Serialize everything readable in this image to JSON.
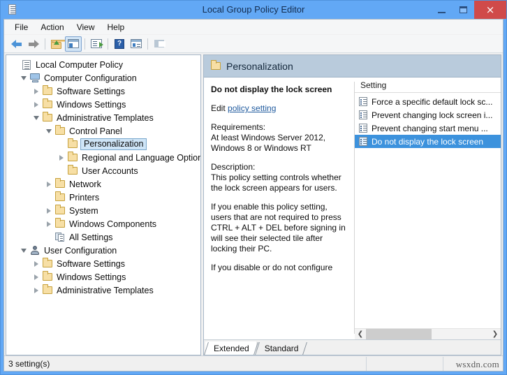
{
  "window": {
    "title": "Local Group Policy Editor",
    "icon": "policy-document-icon",
    "minimize_label": "",
    "maximize_label": "",
    "close_label": "×",
    "accent_color": "#62a8f5",
    "close_color": "#d04a4a"
  },
  "menubar": {
    "items": [
      {
        "label": "File"
      },
      {
        "label": "Action"
      },
      {
        "label": "View"
      },
      {
        "label": "Help"
      }
    ]
  },
  "toolbar": {
    "buttons": [
      {
        "name": "back-button",
        "icon": "back-arrow-icon"
      },
      {
        "name": "forward-button",
        "icon": "forward-arrow-icon"
      },
      {
        "name": "up-one-level-button",
        "icon": "folder-up-icon"
      },
      {
        "name": "show-hide-console-tree-button",
        "icon": "console-tree-icon",
        "pressed": true
      },
      {
        "name": "export-list-button",
        "icon": "export-list-icon"
      },
      {
        "name": "help-button",
        "icon": "help-question-icon"
      },
      {
        "name": "properties-button",
        "icon": "properties-icon"
      },
      {
        "name": "filter-button",
        "icon": "filter-funnel-icon"
      }
    ]
  },
  "tree": {
    "nodes": [
      {
        "label": "Local Computer Policy",
        "indent": 0,
        "expander": "none",
        "icon": "policy-document-icon",
        "selected": false
      },
      {
        "label": "Computer Configuration",
        "indent": 1,
        "expander": "expanded",
        "icon": "computer-icon",
        "selected": false
      },
      {
        "label": "Software Settings",
        "indent": 2,
        "expander": "collapsed",
        "icon": "folder-icon",
        "selected": false
      },
      {
        "label": "Windows Settings",
        "indent": 2,
        "expander": "collapsed",
        "icon": "folder-icon",
        "selected": false
      },
      {
        "label": "Administrative Templates",
        "indent": 2,
        "expander": "expanded",
        "icon": "folder-icon",
        "selected": false
      },
      {
        "label": "Control Panel",
        "indent": 3,
        "expander": "expanded",
        "icon": "folder-icon",
        "selected": false
      },
      {
        "label": "Personalization",
        "indent": 4,
        "expander": "none",
        "icon": "folder-icon",
        "selected": true
      },
      {
        "label": "Regional and Language Options",
        "indent": 4,
        "expander": "collapsed",
        "icon": "folder-icon",
        "selected": false
      },
      {
        "label": "User Accounts",
        "indent": 4,
        "expander": "none",
        "icon": "folder-icon",
        "selected": false
      },
      {
        "label": "Network",
        "indent": 3,
        "expander": "collapsed",
        "icon": "folder-icon",
        "selected": false
      },
      {
        "label": "Printers",
        "indent": 3,
        "expander": "none",
        "icon": "folder-icon",
        "selected": false
      },
      {
        "label": "System",
        "indent": 3,
        "expander": "collapsed",
        "icon": "folder-icon",
        "selected": false
      },
      {
        "label": "Windows Components",
        "indent": 3,
        "expander": "collapsed",
        "icon": "folder-icon",
        "selected": false
      },
      {
        "label": "All Settings",
        "indent": 3,
        "expander": "none",
        "icon": "all-settings-icon",
        "selected": false
      },
      {
        "label": "User Configuration",
        "indent": 1,
        "expander": "expanded",
        "icon": "user-icon",
        "selected": false
      },
      {
        "label": "Software Settings",
        "indent": 2,
        "expander": "collapsed",
        "icon": "folder-icon",
        "selected": false
      },
      {
        "label": "Windows Settings",
        "indent": 2,
        "expander": "collapsed",
        "icon": "folder-icon",
        "selected": false
      },
      {
        "label": "Administrative Templates",
        "indent": 2,
        "expander": "collapsed",
        "icon": "folder-icon",
        "selected": false
      }
    ]
  },
  "pane": {
    "header_title": "Personalization",
    "header_icon": "folder-icon",
    "header_bg": "#b9cbdc"
  },
  "detail": {
    "setting_title": "Do not display the lock screen",
    "edit_prefix": "Edit",
    "edit_link": "policy setting",
    "requirements_label": "Requirements:",
    "requirements_text": "At least Windows Server 2012, Windows 8 or Windows RT",
    "description_label": "Description:",
    "description_p1": "This policy setting controls whether the lock screen appears for users.",
    "description_p2": "If you enable this policy setting, users that are not required to press CTRL + ALT + DEL before signing in will see their selected tile after locking their PC.",
    "description_p3": "If you disable or do not configure"
  },
  "list": {
    "column_header": "Setting",
    "rows": [
      {
        "label": "Force a specific default lock sc...",
        "icon": "policy-setting-icon",
        "selected": false
      },
      {
        "label": "Prevent changing lock screen i...",
        "icon": "policy-setting-icon",
        "selected": false
      },
      {
        "label": "Prevent changing start menu ...",
        "icon": "policy-setting-icon",
        "selected": false
      },
      {
        "label": "Do not display the lock screen",
        "icon": "policy-setting-icon",
        "selected": true
      }
    ],
    "selection_color": "#3c92dd"
  },
  "scrollbar": {
    "left_glyph": "❮",
    "right_glyph": "❯"
  },
  "tabs": [
    {
      "label": "Extended",
      "active": true
    },
    {
      "label": "Standard",
      "active": false
    }
  ],
  "statusbar": {
    "text": "3 setting(s)"
  },
  "watermark": "wsxdn.com"
}
